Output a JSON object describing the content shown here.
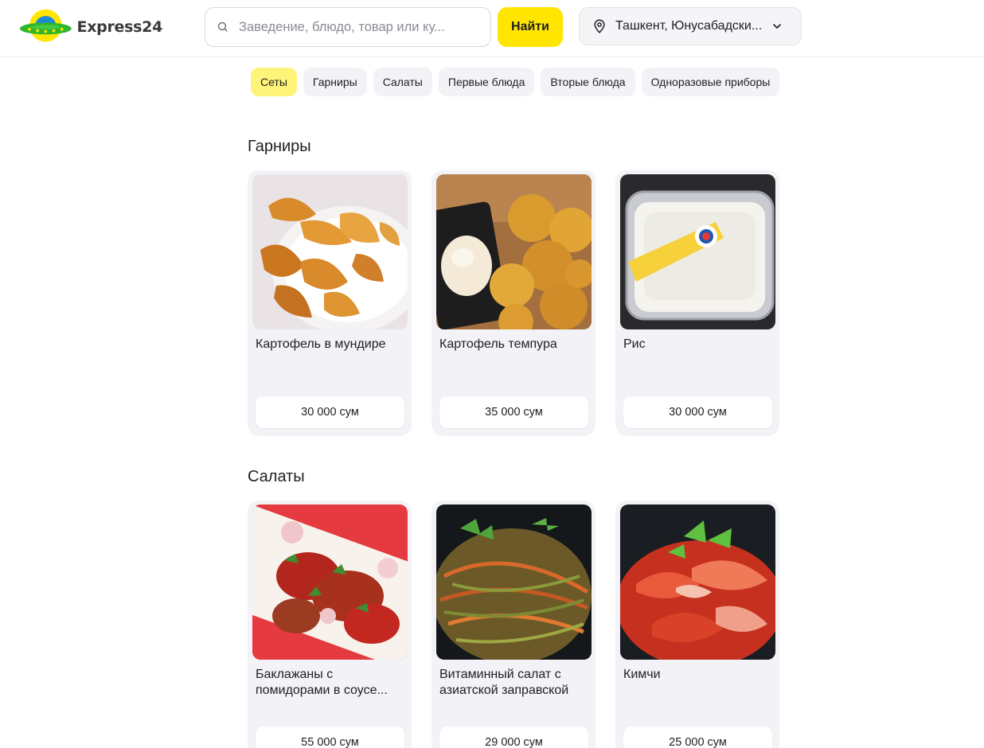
{
  "header": {
    "logo_text": "Express24",
    "search_placeholder": "Заведение, блюдо, товар или ку...",
    "find_label": "Найти",
    "location": "Ташкент, Юнусабадски..."
  },
  "categories": [
    {
      "label": "Сеты",
      "active": true
    },
    {
      "label": "Гарниры",
      "active": false
    },
    {
      "label": "Салаты",
      "active": false
    },
    {
      "label": "Первые блюда",
      "active": false
    },
    {
      "label": "Вторые блюда",
      "active": false
    },
    {
      "label": "Одноразовые приборы",
      "active": false
    }
  ],
  "sections": [
    {
      "title": "Гарниры",
      "items": [
        {
          "name": "Картофель в мундире",
          "price": "30 000 сум",
          "image": "potato-wedges"
        },
        {
          "name": "Картофель темпура",
          "price": "35 000 сум",
          "image": "tempura-potato"
        },
        {
          "name": "Рис",
          "price": "30 000 сум",
          "image": "rice-container"
        }
      ]
    },
    {
      "title": "Салаты",
      "items": [
        {
          "name": "Баклажаны с помидорами в соусе...",
          "price": "55 000 сум",
          "image": "eggplant-tomato"
        },
        {
          "name": "Витаминный салат с азиатской заправской",
          "price": "29 000 сум",
          "image": "vitamin-salad"
        },
        {
          "name": "Кимчи",
          "price": "25 000 сум",
          "image": "kimchi"
        }
      ]
    }
  ],
  "colors": {
    "accent_yellow": "#ffe500",
    "active_chip": "#fff47a",
    "card_bg": "#f3f3f7",
    "logo_green": "#2fb52c",
    "logo_blue": "#1e88d8"
  }
}
